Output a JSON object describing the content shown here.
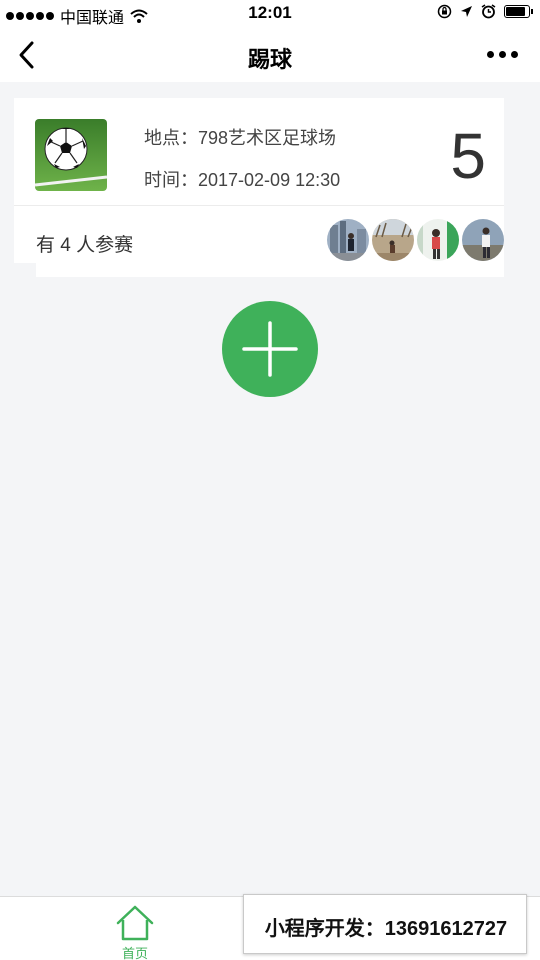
{
  "status_bar": {
    "carrier": "中国联通",
    "time": "12:01",
    "battery_level": 0.9
  },
  "nav": {
    "title": "踢球",
    "back_icon": "chevron-left-icon",
    "more_icon": "more-dots-icon"
  },
  "event": {
    "location_label": "地点：",
    "location": "798艺术区足球场",
    "time_label": "时间：",
    "time": "2017-02-09 12:30",
    "count": "5",
    "participants_text": "有 4 人参赛",
    "image_icon": "soccer-ball-image",
    "avatars": [
      {
        "name": "avatar-1"
      },
      {
        "name": "avatar-2"
      },
      {
        "name": "avatar-3"
      },
      {
        "name": "avatar-4"
      }
    ]
  },
  "add_button": {
    "icon": "plus-icon",
    "color": "#3fb15a"
  },
  "tab_bar": {
    "home_label": "首页",
    "home_icon": "home-icon",
    "active_color": "#3fb15a"
  },
  "watermark": {
    "text": "小程序开发：13691612727"
  }
}
